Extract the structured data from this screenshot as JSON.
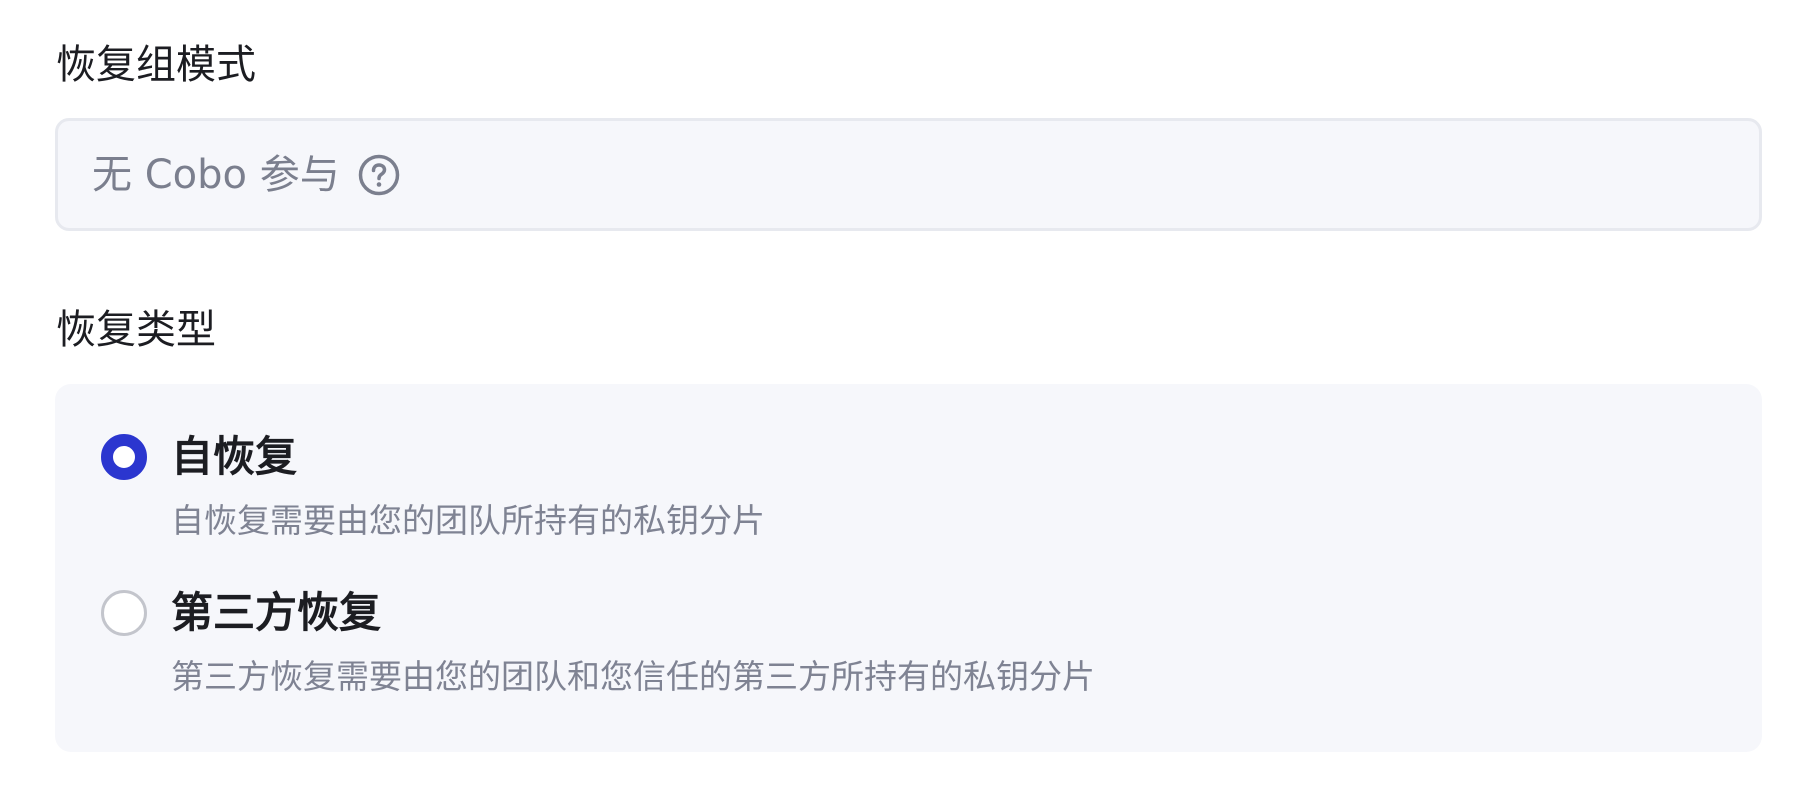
{
  "recovery_mode": {
    "label": "恢复组模式",
    "value": "无 Cobo 参与",
    "help_icon": "question-circle-icon"
  },
  "recovery_type": {
    "label": "恢复类型",
    "selected": "self",
    "options": [
      {
        "id": "self",
        "title": "自恢复",
        "description": "自恢复需要由您的团队所持有的私钥分片",
        "checked": true
      },
      {
        "id": "third_party",
        "title": "第三方恢复",
        "description": "第三方恢复需要由您的团队和您信任的第三方所持有的私钥分片",
        "checked": false
      }
    ]
  },
  "colors": {
    "accent": "#2b36cf",
    "field_background": "#f6f7fb",
    "field_border": "#e7e9ef",
    "muted_text": "#7f8393",
    "primary_text": "#1c1d22"
  }
}
